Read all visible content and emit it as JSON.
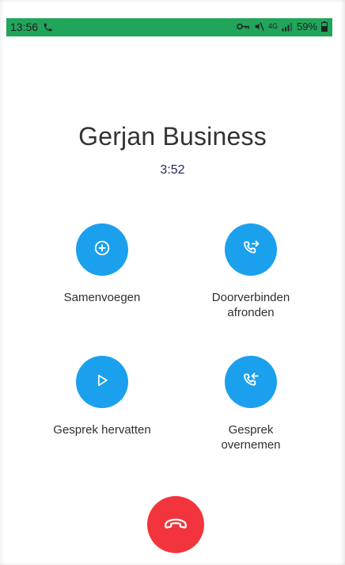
{
  "status_bar": {
    "time": "13:56",
    "net_label": "4G",
    "battery": "59%",
    "color": "#21a55b"
  },
  "call": {
    "contact_name": "Gerjan Business",
    "duration": "3:52"
  },
  "actions": [
    {
      "label": "Samenvoegen",
      "icon": "plus-circle-icon"
    },
    {
      "label": "Doorverbinden\nafronden",
      "icon": "phone-transfer-out-icon"
    },
    {
      "label": "Gesprek hervatten",
      "icon": "play-icon"
    },
    {
      "label": "Gesprek\novernemen",
      "icon": "phone-transfer-in-icon"
    }
  ],
  "colors": {
    "action_button": "#1ba0ee",
    "hangup_button": "#f2353d"
  },
  "hangup": {
    "icon": "hang-up-icon"
  }
}
